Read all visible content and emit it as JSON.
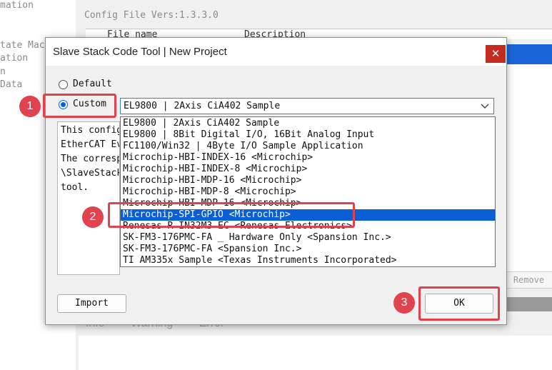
{
  "background": {
    "left_panel_lines": [
      "mation",
      "tate Mac",
      "ation",
      "n",
      "Data"
    ],
    "config_version": "Config File Vers:1.3.3.0",
    "header_cols": [
      "File name",
      "Description"
    ],
    "remove_label": "Remove",
    "tabs": [
      "Info",
      "Warning",
      "Error"
    ]
  },
  "dialog": {
    "title": "Slave Stack Code Tool | New Project",
    "close_glyph": "✕",
    "default_label": "Default",
    "custom_label": "Custom",
    "selected_value": "EL9800 | 2Axis CiA402 Sample",
    "description_lines": [
      "This config",
      "EtherCAT Ev",
      "The corresp",
      "\\SlaveStack",
      "tool."
    ],
    "dropdown_items": [
      "EL9800 | 2Axis CiA402 Sample",
      "EL9800 | 8Bit Digital I/O, 16Bit Analog Input",
      "FC1100/Win32 | 4Byte I/O Sample Application",
      "Microchip-HBI-INDEX-16 <Microchip>",
      "Microchip-HBI-INDEX-8 <Microchip>",
      "Microchip-HBI-MDP-16 <Microchip>",
      "Microchip-HBI-MDP-8 <Microchip>",
      "Microchip-HBI-MDP-16 <Microchip>",
      "Microchip-SPI-GPIO <Microchip>",
      "Renesas R-IN32M3-EC <Renesas Electronics>",
      "SK-FM3-176PMC-FA _ Hardware Only <Spansion Inc.>",
      "SK-FM3-176PMC-FA <Spansion Inc.>",
      "TI AM335x Sample <Texas Instruments Incorporated>"
    ],
    "selected_index": 8,
    "import_label": "Import",
    "ok_label": "OK"
  },
  "annotations": {
    "markers": [
      "1",
      "2",
      "3"
    ],
    "color": "#e0424e"
  },
  "colors": {
    "accent": "#0b5fd6",
    "close": "#c42b1c"
  }
}
